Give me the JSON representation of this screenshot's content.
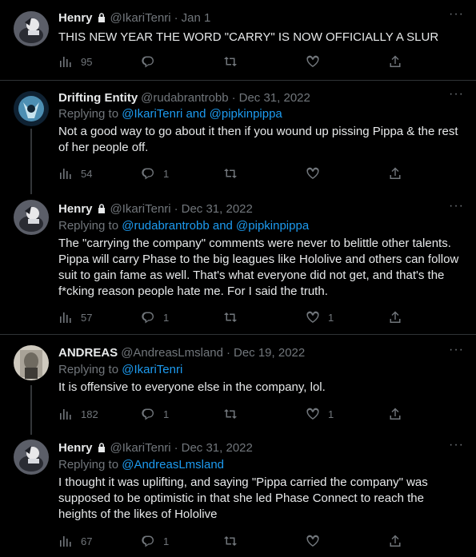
{
  "colors": {
    "background": "#000000",
    "text": "#e7e9ea",
    "muted": "#71767b",
    "link": "#1d9bf0",
    "divider": "#2f3336"
  },
  "tweets": [
    {
      "name": "Henry",
      "handle": "@IkariTenri",
      "sep": "·",
      "date": "Jan 1",
      "replying_prefix": "",
      "replying_to": "",
      "text": "THIS NEW YEAR THE WORD \"CARRY\" IS NOW OFFICIALLY A SLUR",
      "views": "95",
      "replies": "",
      "retweets": "",
      "likes": "",
      "locked": true,
      "avatar": "henry"
    },
    {
      "name": "Drifting Entity",
      "handle": "@rudabrantrobb",
      "sep": "·",
      "date": "Dec 31, 2022",
      "replying_prefix": "Replying to ",
      "replying_to": "@IkariTenri and @pipkinpippa",
      "text": "Not a good way to go about it then if you wound up pissing Pippa & the rest of her people off.",
      "views": "54",
      "replies": "1",
      "retweets": "",
      "likes": "",
      "locked": false,
      "avatar": "drifting"
    },
    {
      "name": "Henry",
      "handle": "@IkariTenri",
      "sep": "·",
      "date": "Dec 31, 2022",
      "replying_prefix": "Replying to ",
      "replying_to": "@rudabrantrobb and @pipkinpippa",
      "text": "The \"carrying the company\" comments were never to belittle other talents. Pippa will carry Phase to the big leagues like Hololive and others can follow suit to gain fame as well. That's what everyone did not get, and that's the f*cking reason people hate me. For I said the truth.",
      "views": "57",
      "replies": "1",
      "retweets": "",
      "likes": "1",
      "locked": true,
      "avatar": "henry"
    },
    {
      "name": "ANDREAS",
      "handle": "@AndreasLmsland",
      "sep": "·",
      "date": "Dec 19, 2022",
      "replying_prefix": "Replying to ",
      "replying_to": "@IkariTenri",
      "text": "It is offensive to everyone else in the company, lol.",
      "views": "182",
      "replies": "1",
      "retweets": "",
      "likes": "1",
      "locked": false,
      "avatar": "andreas"
    },
    {
      "name": "Henry",
      "handle": "@IkariTenri",
      "sep": "·",
      "date": "Dec 31, 2022",
      "replying_prefix": "Replying to ",
      "replying_to": "@AndreasLmsland",
      "text": "I thought it was uplifting, and saying \"Pippa carried the company\" was supposed to be optimistic in that she led Phase Connect to reach the heights of the likes of Hololive",
      "views": "67",
      "replies": "1",
      "retweets": "",
      "likes": "",
      "locked": true,
      "avatar": "henry"
    }
  ]
}
